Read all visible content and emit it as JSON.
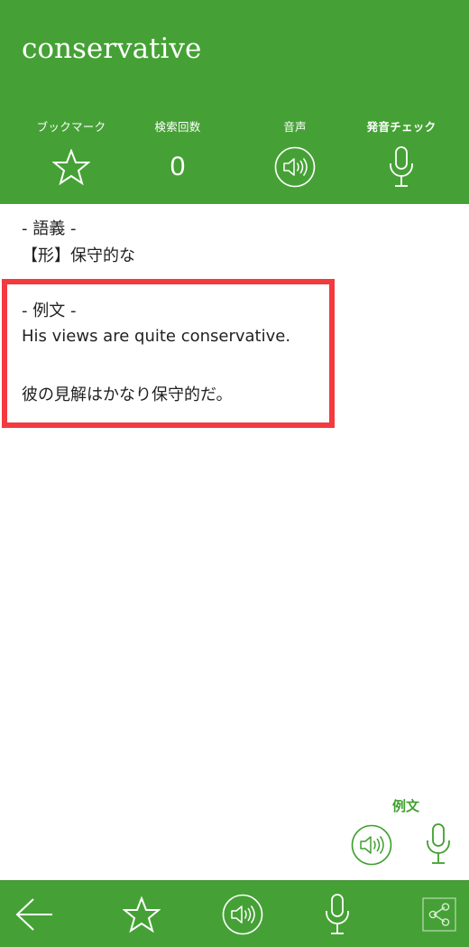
{
  "header": {
    "word": "conservative",
    "stats": [
      {
        "label": "ブックマーク"
      },
      {
        "label": "検索回数",
        "value": "0"
      },
      {
        "label": "音声"
      },
      {
        "label": "発音チェック"
      }
    ]
  },
  "meaning": {
    "title": "- 語義 -",
    "text": "【形】保守的な"
  },
  "example": {
    "title": "- 例文 -",
    "english": "His views are quite conservative.",
    "japanese": "彼の見解はかなり保守的だ。"
  },
  "example_controls": {
    "label": "例文"
  },
  "colors": {
    "primary_green": "#45a135",
    "label_green": "#3fa02e",
    "highlight_red": "#f23a3f"
  },
  "icons": {
    "bookmark": "star-icon",
    "sound": "speaker-icon",
    "mic": "microphone-icon",
    "back": "back-arrow-icon",
    "share": "share-icon"
  }
}
